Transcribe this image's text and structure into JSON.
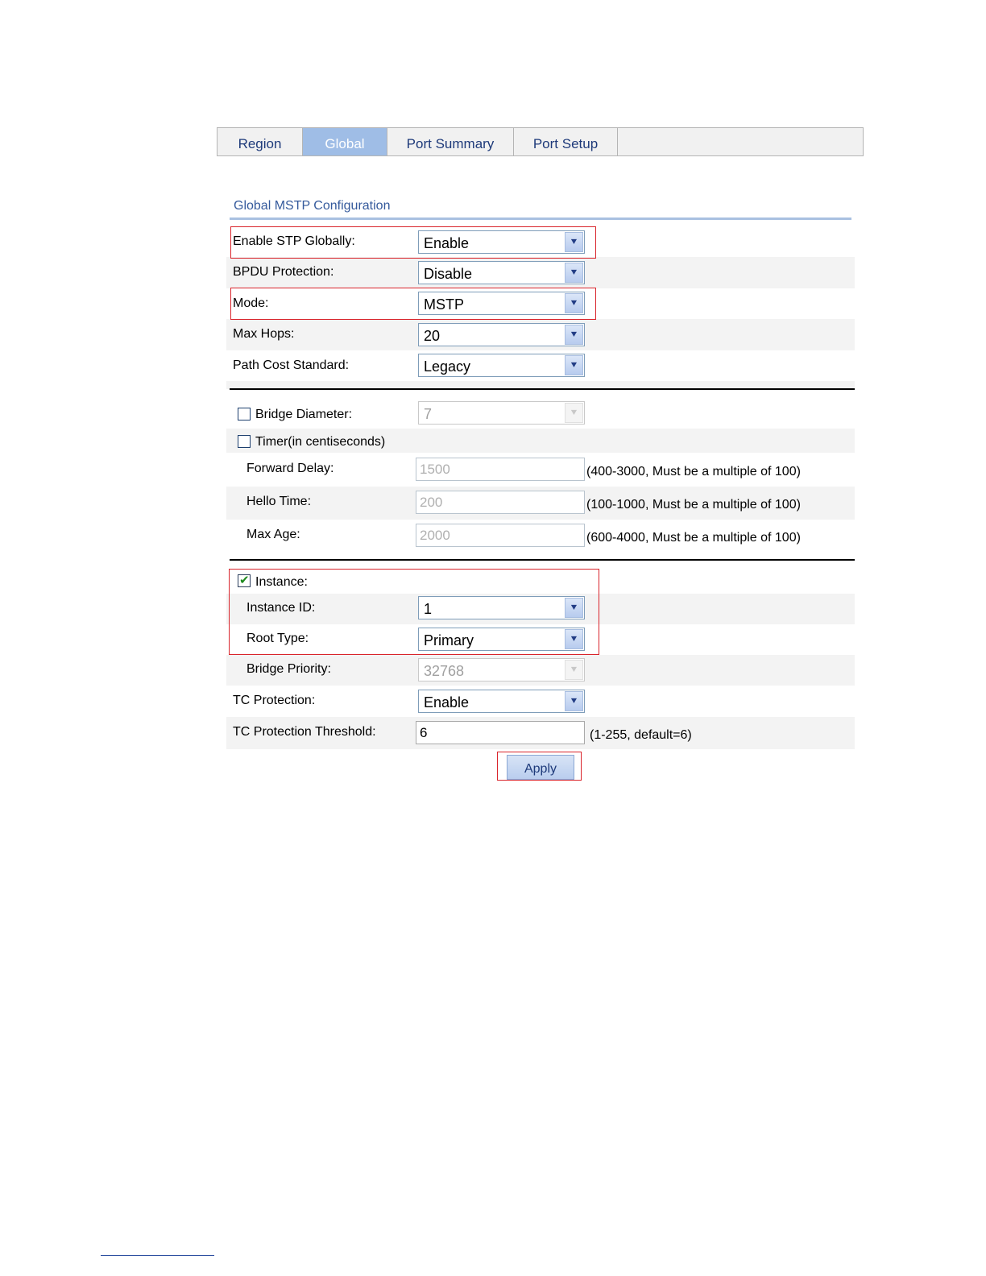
{
  "tabs": [
    {
      "label": "Region",
      "active": false
    },
    {
      "label": "Global",
      "active": true
    },
    {
      "label": "Port Summary",
      "active": false
    },
    {
      "label": "Port Setup",
      "active": false
    }
  ],
  "section_title": "Global MSTP Configuration",
  "fields": {
    "enable_stp": {
      "label": "Enable STP Globally:",
      "value": "Enable"
    },
    "bpdu_protection": {
      "label": "BPDU Protection:",
      "value": "Disable"
    },
    "mode": {
      "label": "Mode:",
      "value": "MSTP"
    },
    "max_hops": {
      "label": "Max Hops:",
      "value": "20"
    },
    "path_cost": {
      "label": "Path Cost Standard:",
      "value": "Legacy"
    },
    "bridge_diameter": {
      "label": "Bridge Diameter:",
      "value": "7",
      "checked": false
    },
    "timer": {
      "label": "Timer(in centiseconds)",
      "checked": false
    },
    "forward_delay": {
      "label": "Forward Delay:",
      "value": "1500",
      "hint": "(400-3000, Must be a multiple of 100)"
    },
    "hello_time": {
      "label": "Hello Time:",
      "value": "200",
      "hint": "(100-1000, Must be a multiple of 100)"
    },
    "max_age": {
      "label": "Max Age:",
      "value": "2000",
      "hint": "(600-4000, Must be a multiple of 100)"
    },
    "instance": {
      "label": "Instance:",
      "checked": true
    },
    "instance_id": {
      "label": "Instance ID:",
      "value": "1"
    },
    "root_type": {
      "label": "Root Type:",
      "value": "Primary"
    },
    "bridge_priority": {
      "label": "Bridge Priority:",
      "value": "32768"
    },
    "tc_protection": {
      "label": "TC Protection:",
      "value": "Enable"
    },
    "tc_threshold": {
      "label": "TC Protection Threshold:",
      "value": "6",
      "hint": "(1-255, default=6)"
    }
  },
  "apply_label": "Apply",
  "icons": {
    "dropdown": "chevron-down-icon",
    "check": "check-icon"
  },
  "colors": {
    "tab_active_bg": "#9fbde6",
    "highlight_box": "#d9242b",
    "title": "#355a9c"
  }
}
